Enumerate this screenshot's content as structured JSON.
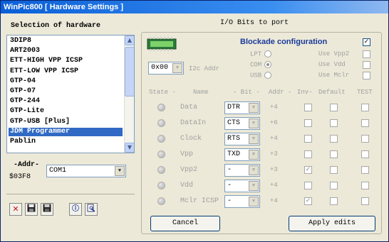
{
  "window": {
    "title": "WinPic800 [ Hardware Settings ]"
  },
  "left": {
    "header": "Selection of hardware",
    "items": [
      "3DIP8",
      "ART2003",
      "ETT-HIGH VPP ICSP",
      "ETT-LOW VPP ICSP",
      "GTP-04",
      "GTP-07",
      "GTP-244",
      "GTP-Lite",
      "GTP-USB [Plus]",
      "JDM Programmer",
      "Pablin"
    ],
    "selected_index": 9,
    "addr_label": "-Addr-",
    "addr_value": "$03F8",
    "port_value": "COM1"
  },
  "right": {
    "header": "I/O Bits to port",
    "blockade_title": "Blockade configuration",
    "blockade_checked": true,
    "i2c_value": "0x00",
    "i2c_label": "I2c Addr",
    "ports": [
      {
        "label": "LPT",
        "checked": false
      },
      {
        "label": "COM",
        "checked": true
      },
      {
        "label": "USB",
        "checked": false
      }
    ],
    "uses": [
      {
        "label": "Use Vpp2",
        "checked": false
      },
      {
        "label": "Use Vdd",
        "checked": false
      },
      {
        "label": "Use Mclr",
        "checked": false
      }
    ],
    "columns": {
      "state": "State -",
      "name": "Name",
      "bit": "- Bit -",
      "addr": "Addr -",
      "inv": "Inv-",
      "default": "Default",
      "test": "TEST"
    },
    "rows": [
      {
        "name": "Data",
        "bit": "DTR",
        "addr": "+4",
        "inv": false,
        "def": false,
        "test": false
      },
      {
        "name": "DataIn",
        "bit": "CTS",
        "addr": "+6",
        "inv": false,
        "def": false,
        "test": false
      },
      {
        "name": "Clock",
        "bit": "RTS",
        "addr": "+4",
        "inv": false,
        "def": false,
        "test": false
      },
      {
        "name": "Vpp",
        "bit": "TXD",
        "addr": "+3",
        "inv": false,
        "def": false,
        "test": false
      },
      {
        "name": "Vpp2",
        "bit": "-",
        "addr": "+3",
        "inv": true,
        "def": false,
        "test": false
      },
      {
        "name": "Vdd",
        "bit": "-",
        "addr": "+4",
        "inv": false,
        "def": false,
        "test": false
      },
      {
        "name": "Mclr ICSP",
        "bit": "-",
        "addr": "+4",
        "inv": true,
        "def": false,
        "test": false
      }
    ],
    "cancel_label": "Cancel",
    "apply_label": "Apply edits"
  },
  "toolbar": [
    "delete-icon",
    "save-icon",
    "save-as-icon",
    "info-icon",
    "auto-detect-icon"
  ],
  "colors": {
    "title_bar": "#0a5fd8",
    "selected": "#316ac5",
    "blockade": "#1a3a9a",
    "face": "#ece9d8"
  }
}
